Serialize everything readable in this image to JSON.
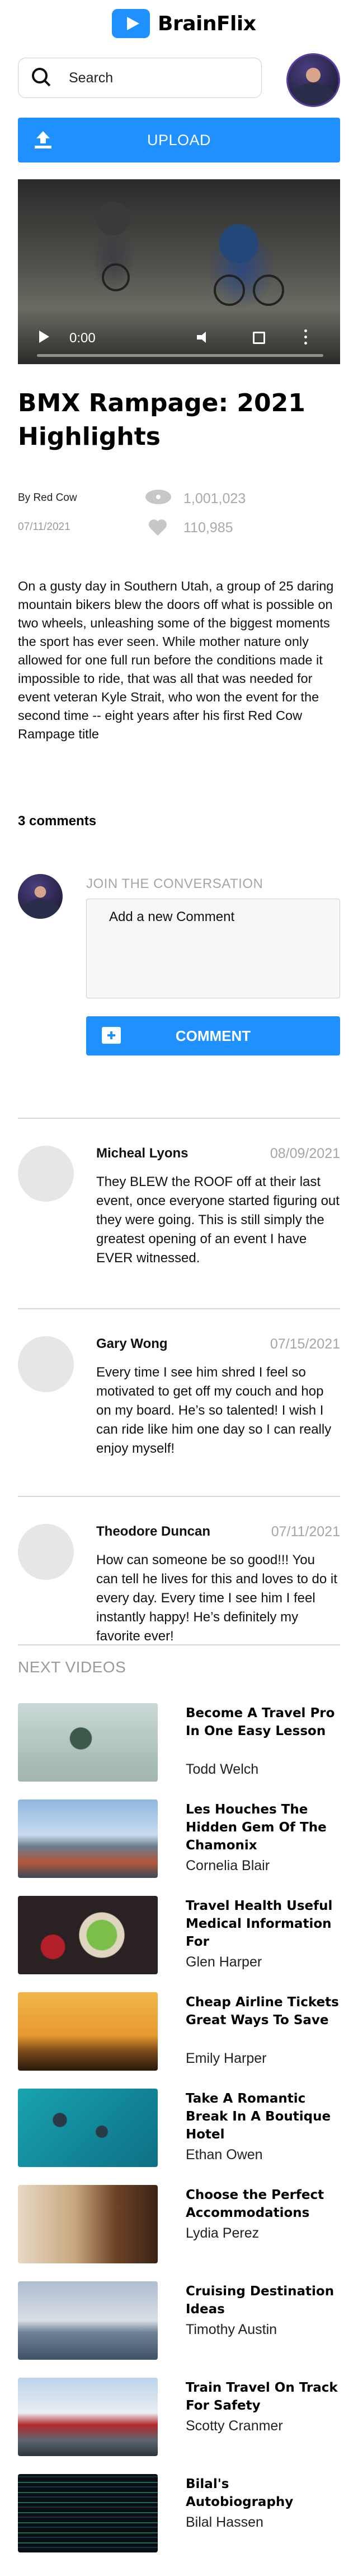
{
  "header": {
    "brand": "BrainFlix",
    "search_placeholder": "Search",
    "upload_label": "UPLOAD"
  },
  "video": {
    "current_time": "0:00",
    "progress": 0
  },
  "main": {
    "title": "BMX Rampage: 2021 Highlights",
    "channel": "By Red Cow",
    "date": "07/11/2021",
    "views": "1,001,023",
    "likes": "110,985",
    "description": "On a gusty day in Southern Utah, a group of 25 daring mountain bikers blew the doors off what is possible on two wheels, unleashing some of the biggest moments the sport has ever seen. While mother nature only allowed for one full run before the conditions made it impossible to ride, that was all that was needed for event veteran Kyle Strait, who won the event for the second time -- eight years after his first Red Cow Rampage title"
  },
  "comments": {
    "count_label": "3 comments",
    "join_label": "JOIN THE CONVERSATION",
    "input_placeholder": "Add a new Comment",
    "button_label": "COMMENT",
    "items": [
      {
        "name": "Micheal Lyons",
        "date": "08/09/2021",
        "text": "They BLEW the ROOF off at their last event, once everyone started figuring out they were going. This is still simply the greatest opening of an event I have EVER witnessed."
      },
      {
        "name": "Gary Wong",
        "date": "07/15/2021",
        "text": "Every time I see him shred I feel so motivated to get off my couch and hop on my board. He’s so talented! I wish I can ride like him one day so I can really enjoy myself!"
      },
      {
        "name": "Theodore Duncan",
        "date": "07/11/2021",
        "text": "How can someone be so good!!! You can tell he lives for this and loves to do it every day. Every time I see him I feel instantly happy! He’s definitely my favorite ever!"
      }
    ]
  },
  "next_videos": {
    "label": "NEXT VIDEOS",
    "items": [
      {
        "title": "Become A Travel Pro In One Easy Lesson",
        "author": "Todd Welch"
      },
      {
        "title": "Les Houches The Hidden Gem Of The Chamonix",
        "author": "Cornelia Blair"
      },
      {
        "title": "Travel Health Useful Medical Information For",
        "author": "Glen Harper"
      },
      {
        "title": "Cheap Airline Tickets Great Ways To Save",
        "author": "Emily Harper"
      },
      {
        "title": "Take A Romantic Break In A Boutique Hotel",
        "author": "Ethan Owen"
      },
      {
        "title": "Choose the Perfect Accommodations",
        "author": "Lydia Perez"
      },
      {
        "title": "Cruising Destination Ideas",
        "author": "Timothy Austin"
      },
      {
        "title": "Train Travel On Track For Safety",
        "author": "Scotty Cranmer"
      },
      {
        "title": "Bilal's Autobiography",
        "author": "Bilal Hassen"
      }
    ]
  },
  "colors": {
    "accent": "#1e90ff",
    "muted_text": "#a6a6a6",
    "divider": "#d6d6d6"
  }
}
